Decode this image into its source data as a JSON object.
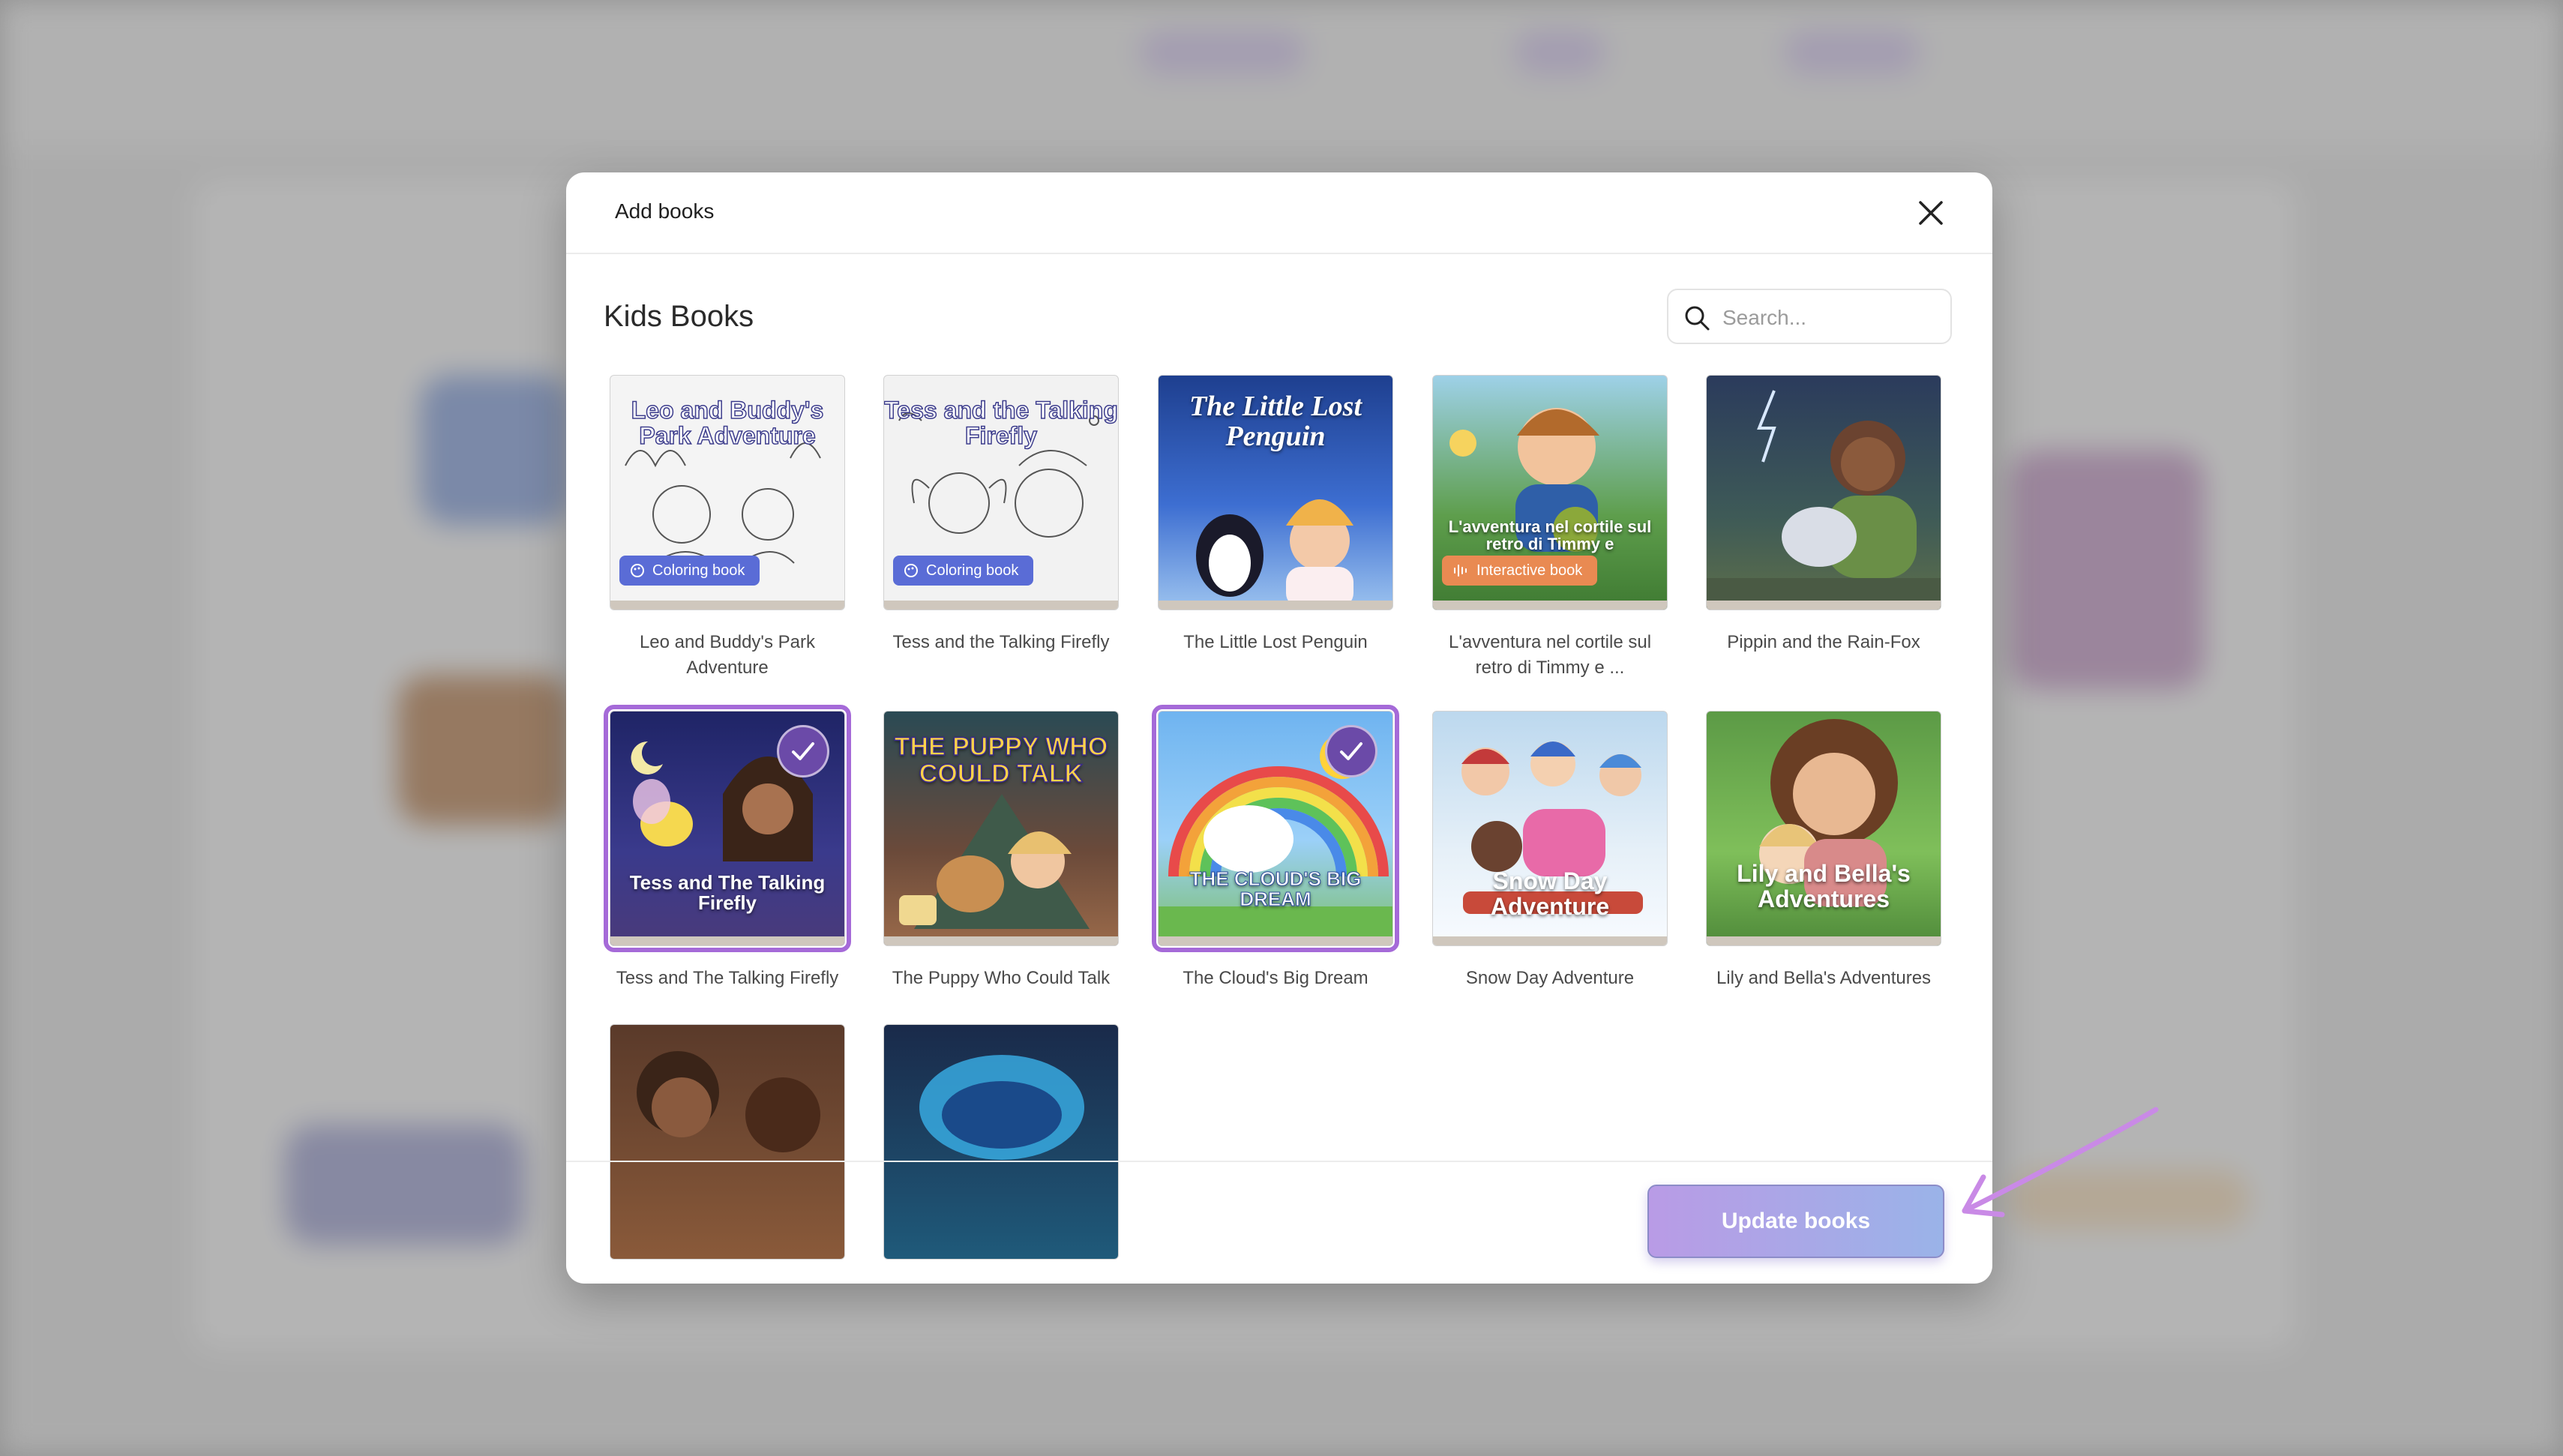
{
  "modal": {
    "title": "Add books",
    "section_title": "Kids Books",
    "search_placeholder": "Search...",
    "update_button": "Update books"
  },
  "badges": {
    "coloring": "Coloring book",
    "interactive": "Interactive book"
  },
  "books": [
    {
      "title": "Leo and Buddy's Park Adventure",
      "cover_text": "Leo and Buddy's Park Adventure",
      "badge": "coloring",
      "selected": false
    },
    {
      "title": "Tess and the Talking Firefly",
      "cover_text": "Tess and the Talking Firefly",
      "badge": "coloring",
      "selected": false
    },
    {
      "title": "The Little Lost Penguin",
      "cover_text": "The Little Lost Penguin",
      "badge": "",
      "selected": false
    },
    {
      "title": "L'avventura nel cortile sul retro di Timmy e ...",
      "cover_text": "L'avventura nel cortile sul retro di Timmy e",
      "badge": "interactive",
      "selected": false
    },
    {
      "title": "Pippin and the Rain-Fox",
      "cover_text": "",
      "badge": "",
      "selected": false
    },
    {
      "title": "Tess and The Talking Firefly",
      "cover_text": "Tess and The Talking Firefly",
      "badge": "",
      "selected": true
    },
    {
      "title": "The Puppy Who Could Talk",
      "cover_text": "THE PUPPY WHO COULD TALK",
      "badge": "",
      "selected": false
    },
    {
      "title": "The Cloud's Big Dream",
      "cover_text": "THE CLOUD'S BIG DREAM",
      "badge": "",
      "selected": true
    },
    {
      "title": "Snow Day Adventure",
      "cover_text": "Snow Day Adventure",
      "badge": "",
      "selected": false
    },
    {
      "title": "Lily and Bella's Adventures",
      "cover_text": "Lily and Bella's Adventures",
      "badge": "",
      "selected": false
    }
  ],
  "colors": {
    "accent": "#a56ad8",
    "check": "#6b4aa8",
    "coloring_badge": "#5a6cd6",
    "interactive_badge": "#e98a52"
  }
}
